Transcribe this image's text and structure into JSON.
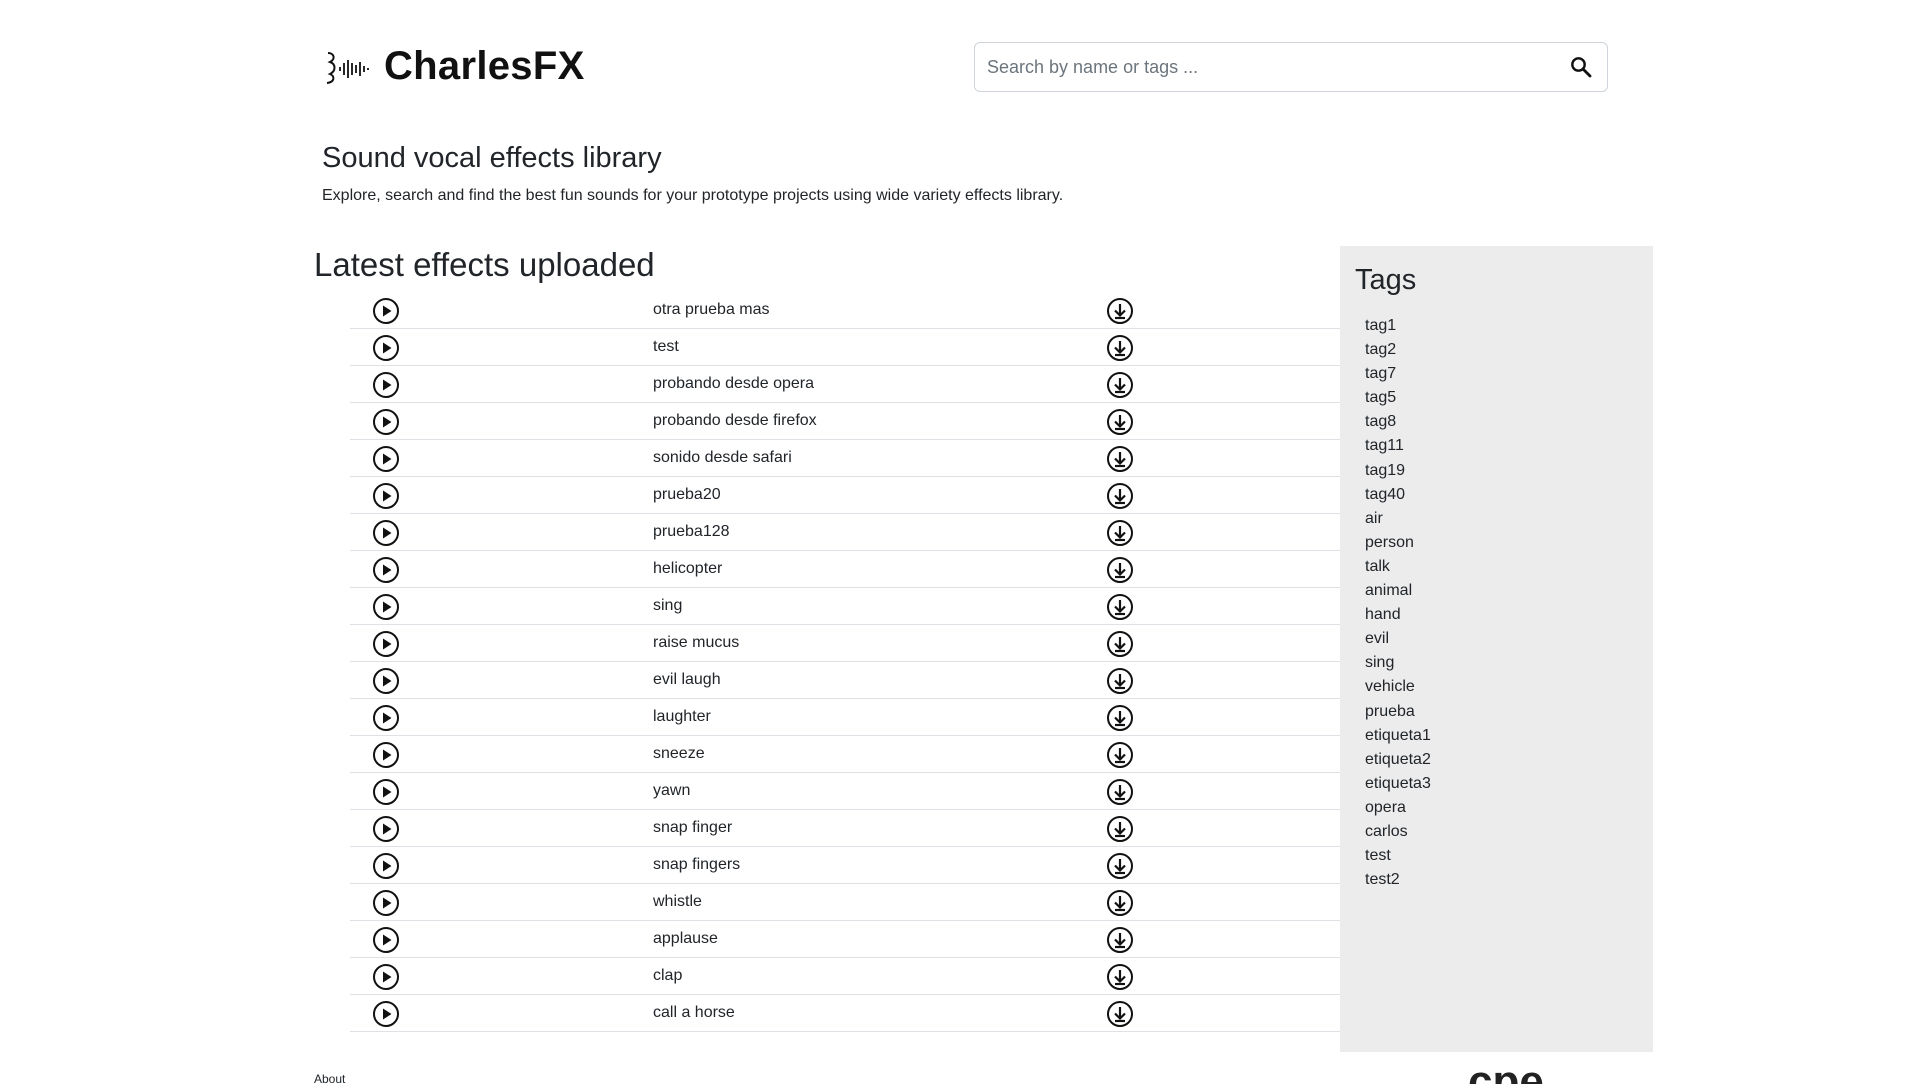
{
  "brand": {
    "name": "CharlesFX",
    "logo_icon": "voice-wave-logo"
  },
  "search": {
    "placeholder": "Search by name or tags ...",
    "value": "",
    "icon": "search-icon"
  },
  "hero": {
    "title": "Sound vocal effects library",
    "subtitle": "Explore, search and find the best fun sounds for your prototype projects using wide variety effects library."
  },
  "latest": {
    "title": "Latest effects uploaded",
    "items": [
      {
        "name": "otra prueba mas"
      },
      {
        "name": "test"
      },
      {
        "name": "probando desde opera"
      },
      {
        "name": "probando desde firefox"
      },
      {
        "name": "sonido desde safari"
      },
      {
        "name": "prueba20"
      },
      {
        "name": "prueba128"
      },
      {
        "name": "helicopter"
      },
      {
        "name": "sing"
      },
      {
        "name": "raise mucus"
      },
      {
        "name": "evil laugh"
      },
      {
        "name": "laughter"
      },
      {
        "name": "sneeze"
      },
      {
        "name": "yawn"
      },
      {
        "name": "snap finger"
      },
      {
        "name": "snap fingers"
      },
      {
        "name": "whistle"
      },
      {
        "name": "applause"
      },
      {
        "name": "clap"
      },
      {
        "name": "call a horse"
      }
    ]
  },
  "tags": {
    "title": "Tags",
    "items": [
      "tag1",
      "tag2",
      "tag7",
      "tag5",
      "tag8",
      "tag11",
      "tag19",
      "tag40",
      "air",
      "person",
      "talk",
      "animal",
      "hand",
      "evil",
      "sing",
      "vehicle",
      "prueba",
      "etiqueta1",
      "etiqueta2",
      "etiqueta3",
      "opera",
      "carlos",
      "test",
      "test2"
    ]
  },
  "footer": {
    "about": "About",
    "logo_text": "cpe"
  },
  "colors": {
    "tags_background": "#ececec",
    "row_border": "#dee2e6",
    "text": "#212529"
  }
}
